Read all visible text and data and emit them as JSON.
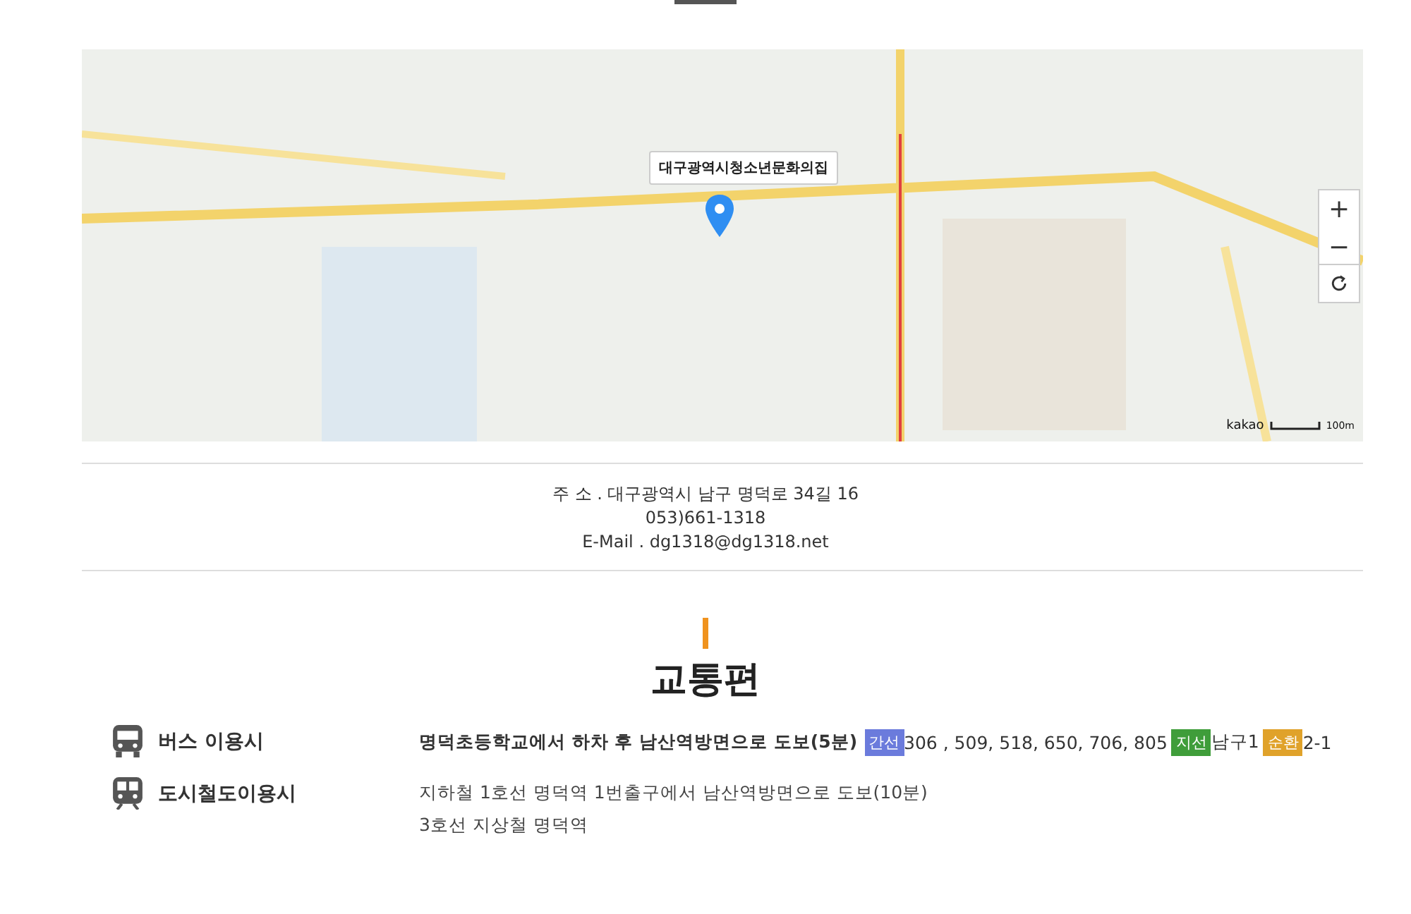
{
  "map": {
    "marker_label": "대구광역시청소년문화의집",
    "zoom_in": "+",
    "zoom_out": "−",
    "attribution": "kakao",
    "scale": "100m"
  },
  "contact": {
    "address": "주 소 . 대구광역시 남구 명덕로 34길 16",
    "phone": "053)661-1318",
    "email": "E-Mail . dg1318@dg1318.net"
  },
  "section_title": "교통편",
  "transport": [
    {
      "kind": "bus",
      "label": "버스 이용시",
      "headline": "명덕초등학교에서 하차 후 남산역방면으로 도보(5분)",
      "routes": [
        {
          "tag": "간선",
          "color": "#6b7bdc",
          "numbers": "306 , 509, 518, 650, 706, 805"
        },
        {
          "tag": "지선",
          "color": "#3f9d3a",
          "numbers": "남구1"
        },
        {
          "tag": "순환",
          "color": "#e0a22a",
          "numbers": "2-1"
        }
      ]
    },
    {
      "kind": "subway",
      "label": "도시철도이용시",
      "lines": [
        "지하철 1호선 명덕역 1번출구에서 남산역방면으로 도보(10분)",
        "3호선 지상철 명덕역"
      ]
    }
  ]
}
